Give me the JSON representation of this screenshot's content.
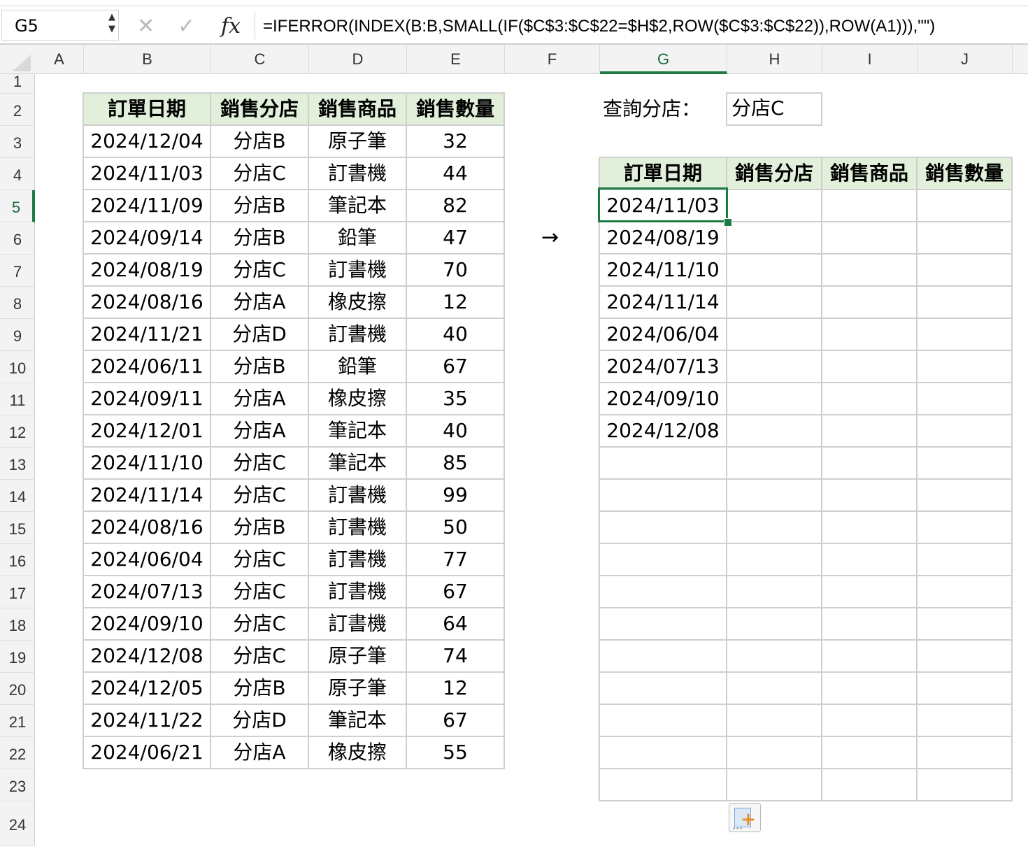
{
  "formula_bar": {
    "name_box": "G5",
    "cancel_icon": "✕",
    "enter_icon": "✓",
    "fx": "fx",
    "formula": "=IFERROR(INDEX(B:B,SMALL(IF($C$3:$C$22=$H$2,ROW($C$3:$C$22)),ROW(A1))),\"\")"
  },
  "columns": [
    "A",
    "B",
    "C",
    "D",
    "E",
    "F",
    "G",
    "H",
    "I",
    "J"
  ],
  "active_column": "G",
  "rows": [
    "1",
    "2",
    "3",
    "4",
    "5",
    "6",
    "7",
    "8",
    "9",
    "10",
    "11",
    "12",
    "13",
    "14",
    "15",
    "16",
    "17",
    "18",
    "19",
    "20",
    "21",
    "22",
    "23",
    "24"
  ],
  "active_row": "5",
  "source_table": {
    "headers": [
      "訂單日期",
      "銷售分店",
      "銷售商品",
      "銷售數量"
    ],
    "rows": [
      [
        "2024/12/04",
        "分店B",
        "原子筆",
        "32"
      ],
      [
        "2024/11/03",
        "分店C",
        "訂書機",
        "44"
      ],
      [
        "2024/11/09",
        "分店B",
        "筆記本",
        "82"
      ],
      [
        "2024/09/14",
        "分店B",
        "鉛筆",
        "47"
      ],
      [
        "2024/08/19",
        "分店C",
        "訂書機",
        "70"
      ],
      [
        "2024/08/16",
        "分店A",
        "橡皮擦",
        "12"
      ],
      [
        "2024/11/21",
        "分店D",
        "訂書機",
        "40"
      ],
      [
        "2024/06/11",
        "分店B",
        "鉛筆",
        "67"
      ],
      [
        "2024/09/11",
        "分店A",
        "橡皮擦",
        "35"
      ],
      [
        "2024/12/01",
        "分店A",
        "筆記本",
        "40"
      ],
      [
        "2024/11/10",
        "分店C",
        "筆記本",
        "85"
      ],
      [
        "2024/11/14",
        "分店C",
        "訂書機",
        "99"
      ],
      [
        "2024/08/16",
        "分店B",
        "訂書機",
        "50"
      ],
      [
        "2024/06/04",
        "分店C",
        "訂書機",
        "77"
      ],
      [
        "2024/07/13",
        "分店C",
        "訂書機",
        "67"
      ],
      [
        "2024/09/10",
        "分店C",
        "訂書機",
        "64"
      ],
      [
        "2024/12/08",
        "分店C",
        "原子筆",
        "74"
      ],
      [
        "2024/12/05",
        "分店B",
        "原子筆",
        "12"
      ],
      [
        "2024/11/22",
        "分店D",
        "筆記本",
        "67"
      ],
      [
        "2024/06/21",
        "分店A",
        "橡皮擦",
        "55"
      ]
    ]
  },
  "arrow": "→",
  "query": {
    "label": "查詢分店：",
    "value": "分店C"
  },
  "result_table": {
    "headers": [
      "訂單日期",
      "銷售分店",
      "銷售商品",
      "銷售數量"
    ],
    "rows": [
      [
        "2024/11/03",
        "",
        "",
        ""
      ],
      [
        "2024/08/19",
        "",
        "",
        ""
      ],
      [
        "2024/11/10",
        "",
        "",
        ""
      ],
      [
        "2024/11/14",
        "",
        "",
        ""
      ],
      [
        "2024/06/04",
        "",
        "",
        ""
      ],
      [
        "2024/07/13",
        "",
        "",
        ""
      ],
      [
        "2024/09/10",
        "",
        "",
        ""
      ],
      [
        "2024/12/08",
        "",
        "",
        ""
      ],
      [
        "",
        "",
        "",
        ""
      ],
      [
        "",
        "",
        "",
        ""
      ],
      [
        "",
        "",
        "",
        ""
      ],
      [
        "",
        "",
        "",
        ""
      ],
      [
        "",
        "",
        "",
        ""
      ],
      [
        "",
        "",
        "",
        ""
      ],
      [
        "",
        "",
        "",
        ""
      ],
      [
        "",
        "",
        "",
        ""
      ],
      [
        "",
        "",
        "",
        ""
      ],
      [
        "",
        "",
        "",
        ""
      ],
      [
        "",
        "",
        "",
        ""
      ]
    ]
  },
  "selected_cell": "G5",
  "accent_color": "#1f7a45",
  "header_fill": "#e2efda",
  "icons": {
    "paste_options": "paste-options-icon"
  }
}
